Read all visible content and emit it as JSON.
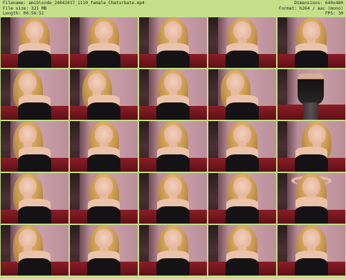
{
  "header": {
    "filename_line": "Filename: amiblonde_24042017_1110_female_Chaturbate.mp4",
    "filesize_line": "File size: 321 MB",
    "length_line": "Length: 00:56:51",
    "dimensions_line": "Dimensions: 640x480",
    "format_line": "Format: h264 / aac (mono)",
    "fps_line": "FPS: 30"
  },
  "thumbnails": [
    {
      "pose": "center"
    },
    {
      "pose": "center"
    },
    {
      "pose": "center"
    },
    {
      "pose": "center"
    },
    {
      "pose": "center"
    },
    {
      "pose": "left"
    },
    {
      "pose": "left"
    },
    {
      "pose": "center"
    },
    {
      "pose": "left"
    },
    {
      "pose": "standing"
    },
    {
      "pose": "left"
    },
    {
      "pose": "center"
    },
    {
      "pose": "center"
    },
    {
      "pose": "center"
    },
    {
      "pose": "right"
    },
    {
      "pose": "left"
    },
    {
      "pose": "center"
    },
    {
      "pose": "center"
    },
    {
      "pose": "center"
    },
    {
      "pose": "arms-up"
    },
    {
      "pose": "left"
    },
    {
      "pose": "center"
    },
    {
      "pose": "center"
    },
    {
      "pose": "center"
    },
    {
      "pose": "center"
    }
  ],
  "colors": {
    "background": "#c5e08a",
    "wall": "#c99fa9",
    "sofa": "#8a1e26",
    "clothing": "#141214",
    "hair": "#c99a4e"
  }
}
